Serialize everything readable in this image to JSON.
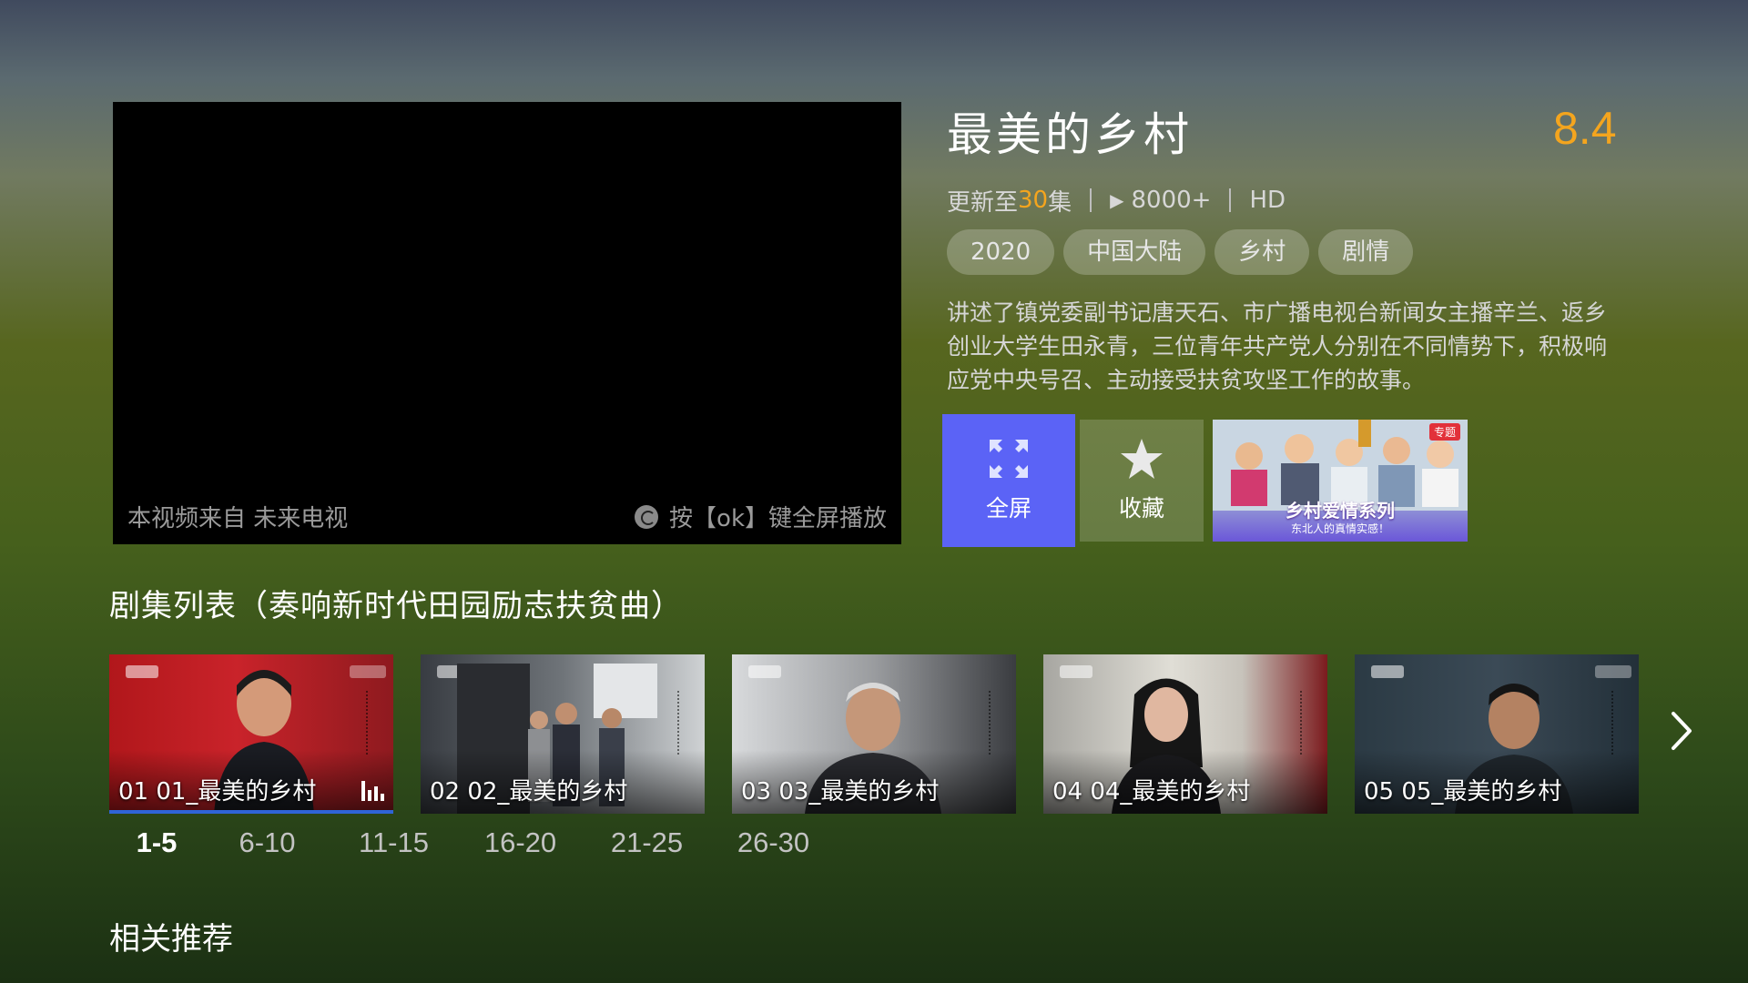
{
  "player": {
    "source_text": "本视频来自 未来电视",
    "fullscreen_hint": "按【ok】键全屏播放"
  },
  "show": {
    "title": "最美的乡村",
    "rating": "8.4",
    "update_prefix": "更新至",
    "update_count": "30",
    "update_suffix": "集",
    "plays": "8000+",
    "quality": "HD",
    "tags": [
      "2020",
      "中国大陆",
      "乡村",
      "剧情"
    ],
    "description": "讲述了镇党委副书记唐天石、市广播电视台新闻女主播辛兰、返乡创业大学生田永青，三位青年共产党人分别在不同情势下，积极响应党中央号召、主动接受扶贫攻坚工作的故事。"
  },
  "actions": {
    "fullscreen_label": "全屏",
    "favorite_label": "收藏",
    "promo_title": "乡村爱情系列",
    "promo_subtitle": "东北人的真情实感！",
    "promo_badge": "专题"
  },
  "episodes": {
    "header": "剧集列表（奏响新时代田园励志扶贫曲）",
    "items": [
      {
        "label": "01 01_最美的乡村",
        "playing": true
      },
      {
        "label": "02 02_最美的乡村",
        "playing": false
      },
      {
        "label": "03 03_最美的乡村",
        "playing": false
      },
      {
        "label": "04 04_最美的乡村",
        "playing": false
      },
      {
        "label": "05 05_最美的乡村",
        "playing": false
      }
    ],
    "ranges": [
      "1-5",
      "6-10",
      "11-15",
      "16-20",
      "21-25",
      "26-30"
    ],
    "active_range": "1-5"
  },
  "recommend": {
    "header": "相关推荐"
  },
  "colors": {
    "accent_rating": "#f4a51e",
    "fullscreen_button": "#5b63f6",
    "progress_bar": "#2f64d6"
  },
  "icons": {
    "fullscreen": "expand-arrows-icon",
    "favorite": "star-icon",
    "playing": "equalizer-icon",
    "next": "chevron-right-icon",
    "plays": "play-triangle-icon",
    "hint": "ok-remote-icon"
  }
}
